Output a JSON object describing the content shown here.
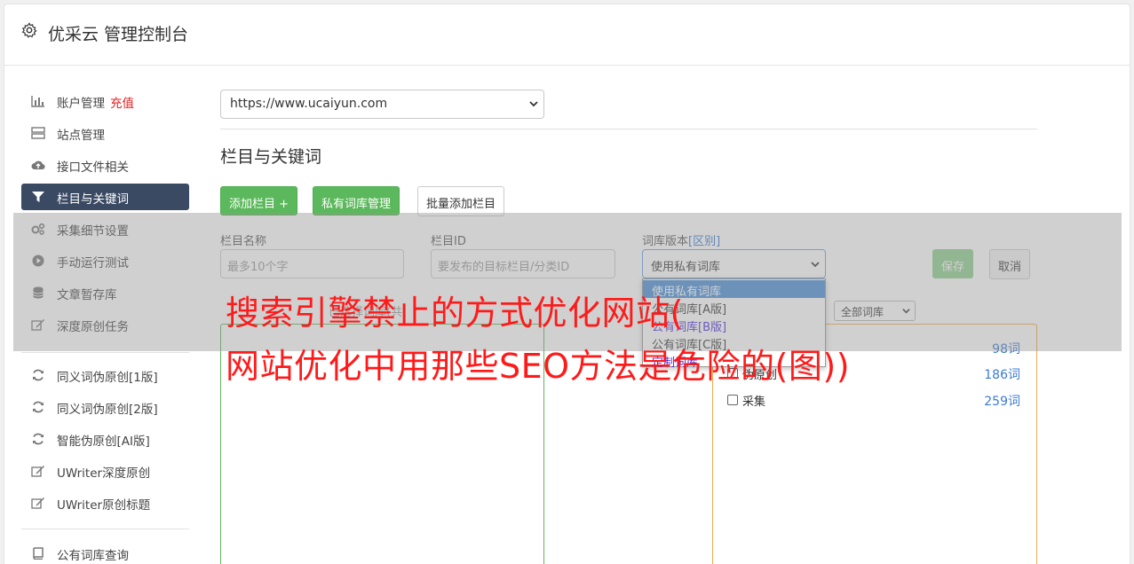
{
  "header": {
    "title": "优采云 管理控制台",
    "icon": "gear-icon"
  },
  "sidebar": {
    "items": [
      {
        "label": "账户管理",
        "extra": "充值",
        "icon": "bar-chart-icon"
      },
      {
        "label": "站点管理",
        "icon": "server-icon"
      },
      {
        "label": "接口文件相关",
        "icon": "cloud-upload-icon"
      },
      {
        "label": "栏目与关键词",
        "icon": "filter-icon",
        "active": true
      },
      {
        "label": "采集细节设置",
        "icon": "gears-icon"
      },
      {
        "label": "手动运行测试",
        "icon": "play-circle-icon"
      },
      {
        "label": "文章暂存库",
        "icon": "database-icon"
      },
      {
        "label": "深度原创任务",
        "icon": "edit-icon"
      },
      {
        "label": "同义词伪原创[1版]",
        "icon": "refresh-icon"
      },
      {
        "label": "同义词伪原创[2版]",
        "icon": "refresh-icon"
      },
      {
        "label": "智能伪原创[AI版]",
        "icon": "refresh-icon"
      },
      {
        "label": "UWriter深度原创",
        "icon": "edit-icon"
      },
      {
        "label": "UWriter原创标题",
        "icon": "edit-icon"
      },
      {
        "label": "公有词库查询",
        "icon": "book-icon"
      }
    ]
  },
  "main": {
    "site_select": "https://www.ucaiyun.com",
    "section_title": "栏目与关键词",
    "buttons": {
      "add_column": "添加栏目 +",
      "private_lib": "私有词库管理",
      "batch_add": "批量添加栏目",
      "save": "保存",
      "cancel": "取消"
    },
    "form": {
      "column_name_label": "栏目名称",
      "column_name_placeholder": "最多10个字",
      "column_id_label": "栏目ID",
      "column_id_placeholder": "要发布的目标栏目/分类ID",
      "lib_version_label": "词库版本",
      "lib_version_link": "[区别]",
      "lib_version_value": "使用私有词库"
    },
    "dropdown_options": [
      "使用私有词库",
      "公有词库[A版]",
      "公有词库[B版]",
      "公有词库[C版]",
      "定制词库"
    ],
    "partial_label": "已选择词库(共",
    "all_lib_select": "全部词库",
    "libraries": [
      {
        "name": "",
        "count": "98词"
      },
      {
        "name": "伪原创",
        "count": "186词"
      },
      {
        "name": "采集",
        "count": "259词"
      }
    ]
  },
  "banner": {
    "line1": "搜索引擎禁止的方式优化网站(",
    "line2": "网站优化中用那些SEO方法是危险的(图))"
  },
  "colors": {
    "accent": "#5cb85c",
    "active_nav": "#3b4a63",
    "banner": "#ff1a1a",
    "link": "#3a7bd5"
  }
}
